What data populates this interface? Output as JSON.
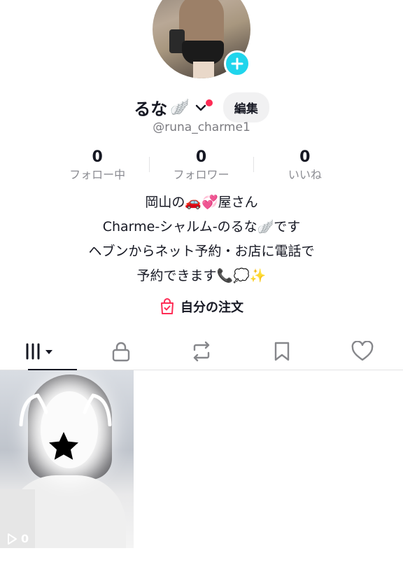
{
  "profile": {
    "display_name": "るな",
    "name_emoji": "🪽",
    "handle": "@runa_charme1",
    "edit_label": "編集"
  },
  "stats": [
    {
      "value": "0",
      "label": "フォロー中"
    },
    {
      "value": "0",
      "label": "フォロワー"
    },
    {
      "value": "0",
      "label": "いいね"
    }
  ],
  "bio": {
    "line1": "岡山の🚗💞屋さん",
    "line2": "Charme-シャルム-のるな🪽です",
    "line3": "ヘブンからネット予約・お店に電話で",
    "line4": "予約できます📞💭✨"
  },
  "orders_label": "自分の注文",
  "tabs": [
    "videos-icon",
    "lock-icon",
    "repost-icon",
    "bookmark-icon",
    "heart-icon"
  ],
  "videos": [
    {
      "views": "0"
    }
  ],
  "colors": {
    "accent": "#fe2c55",
    "add_badge": "#20d5ec"
  }
}
